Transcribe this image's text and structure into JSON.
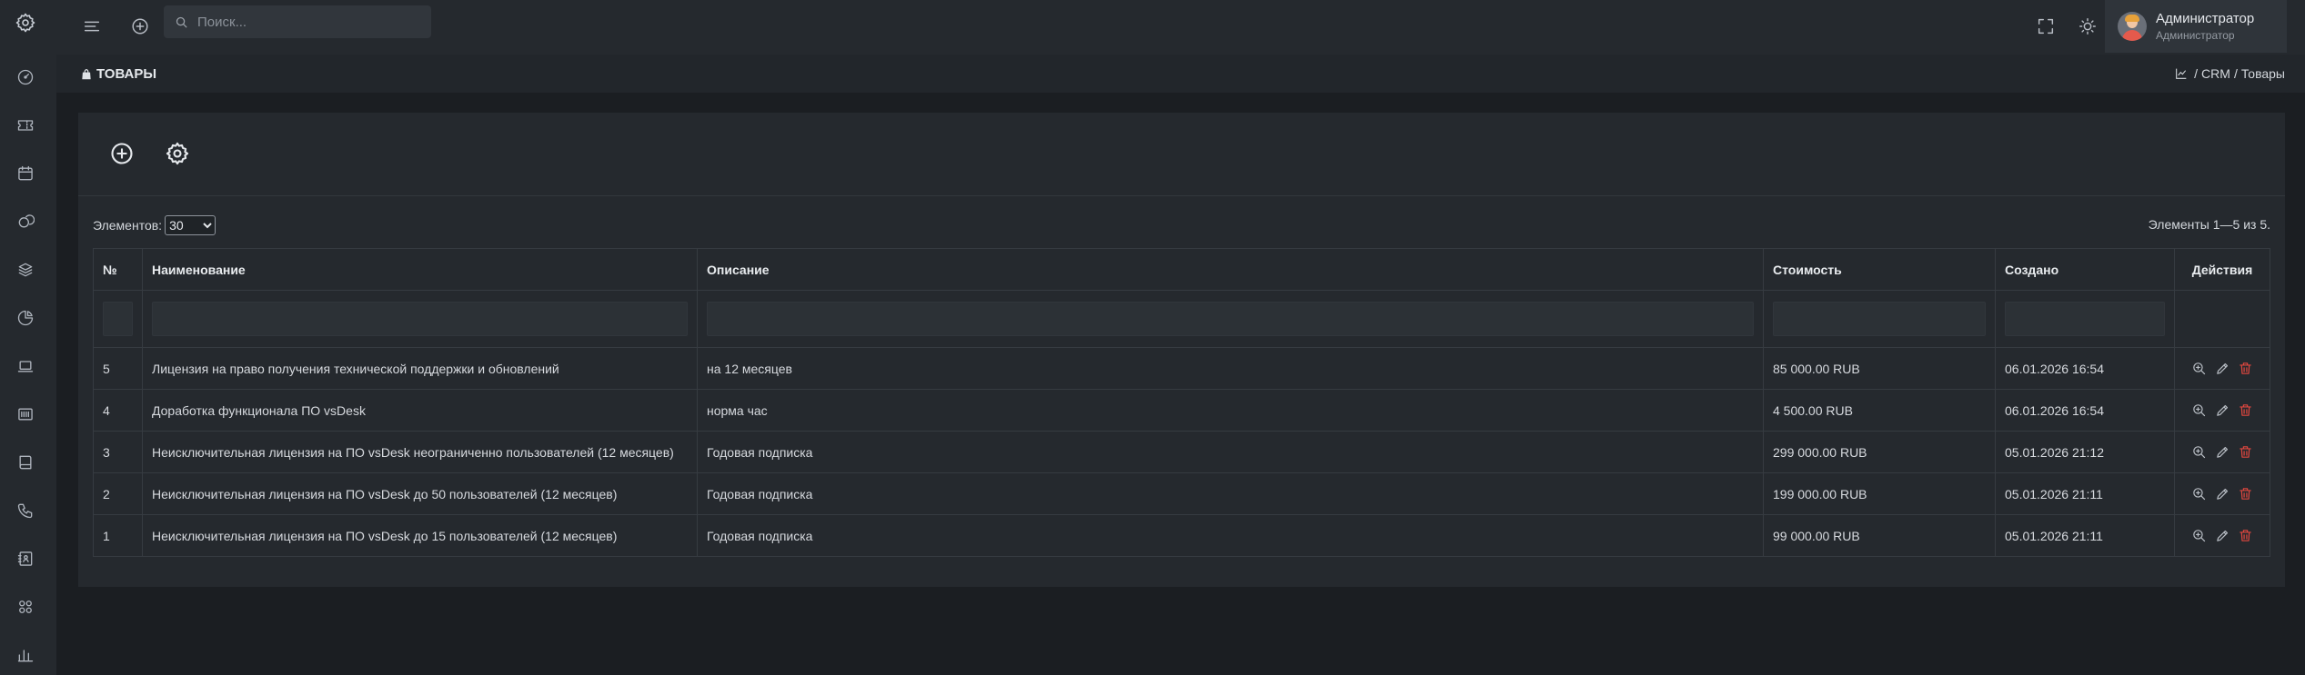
{
  "colors": {
    "background": "#1b1e22",
    "panel": "#25292e",
    "delete": "#e0473f"
  },
  "sidebar": {
    "items": [
      {
        "name": "gear-icon"
      },
      {
        "name": "gauge-icon"
      },
      {
        "name": "ticket-icon"
      },
      {
        "name": "calendar-icon"
      },
      {
        "name": "coins-icon"
      },
      {
        "name": "layers-icon"
      },
      {
        "name": "pie-chart-icon"
      },
      {
        "name": "laptop-icon"
      },
      {
        "name": "barcode-icon"
      },
      {
        "name": "book-icon"
      },
      {
        "name": "phone-icon"
      },
      {
        "name": "contacts-icon"
      },
      {
        "name": "apps-icon"
      },
      {
        "name": "bar-chart-icon"
      }
    ]
  },
  "topbar": {
    "search_placeholder": "Поиск...",
    "user": {
      "name": "Администратор",
      "role": "Администратор"
    }
  },
  "page": {
    "title": "ТОВАРЫ",
    "breadcrumb": {
      "section": "CRM",
      "current": "Товары",
      "separator": "/"
    }
  },
  "table": {
    "length_label": "Элементов:",
    "length_value": "30",
    "info": "Элементы 1—5 из 5.",
    "headers": {
      "num": "№",
      "name": "Наименование",
      "description": "Описание",
      "cost": "Стоимость",
      "created": "Создано",
      "actions": "Действия"
    },
    "rows": [
      {
        "num": "5",
        "name": "Лицензия на право получения технической поддержки и обновлений",
        "description": "на 12 месяцев",
        "cost": "85 000.00 RUB",
        "created": "06.01.2026 16:54"
      },
      {
        "num": "4",
        "name": "Доработка функционала ПО vsDesk",
        "description": "норма час",
        "cost": "4 500.00 RUB",
        "created": "06.01.2026 16:54"
      },
      {
        "num": "3",
        "name": "Неисключительная лицензия на ПО vsDesk неограниченно пользователей (12 месяцев)",
        "description": "Годовая подписка",
        "cost": "299 000.00 RUB",
        "created": "05.01.2026 21:12"
      },
      {
        "num": "2",
        "name": "Неисключительная лицензия на ПО vsDesk до 50 пользователей (12 месяцев)",
        "description": "Годовая подписка",
        "cost": "199 000.00 RUB",
        "created": "05.01.2026 21:11"
      },
      {
        "num": "1",
        "name": "Неисключительная лицензия на ПО vsDesk до 15 пользователей (12 месяцев)",
        "description": "Годовая подписка",
        "cost": "99 000.00 RUB",
        "created": "05.01.2026 21:11"
      }
    ]
  }
}
